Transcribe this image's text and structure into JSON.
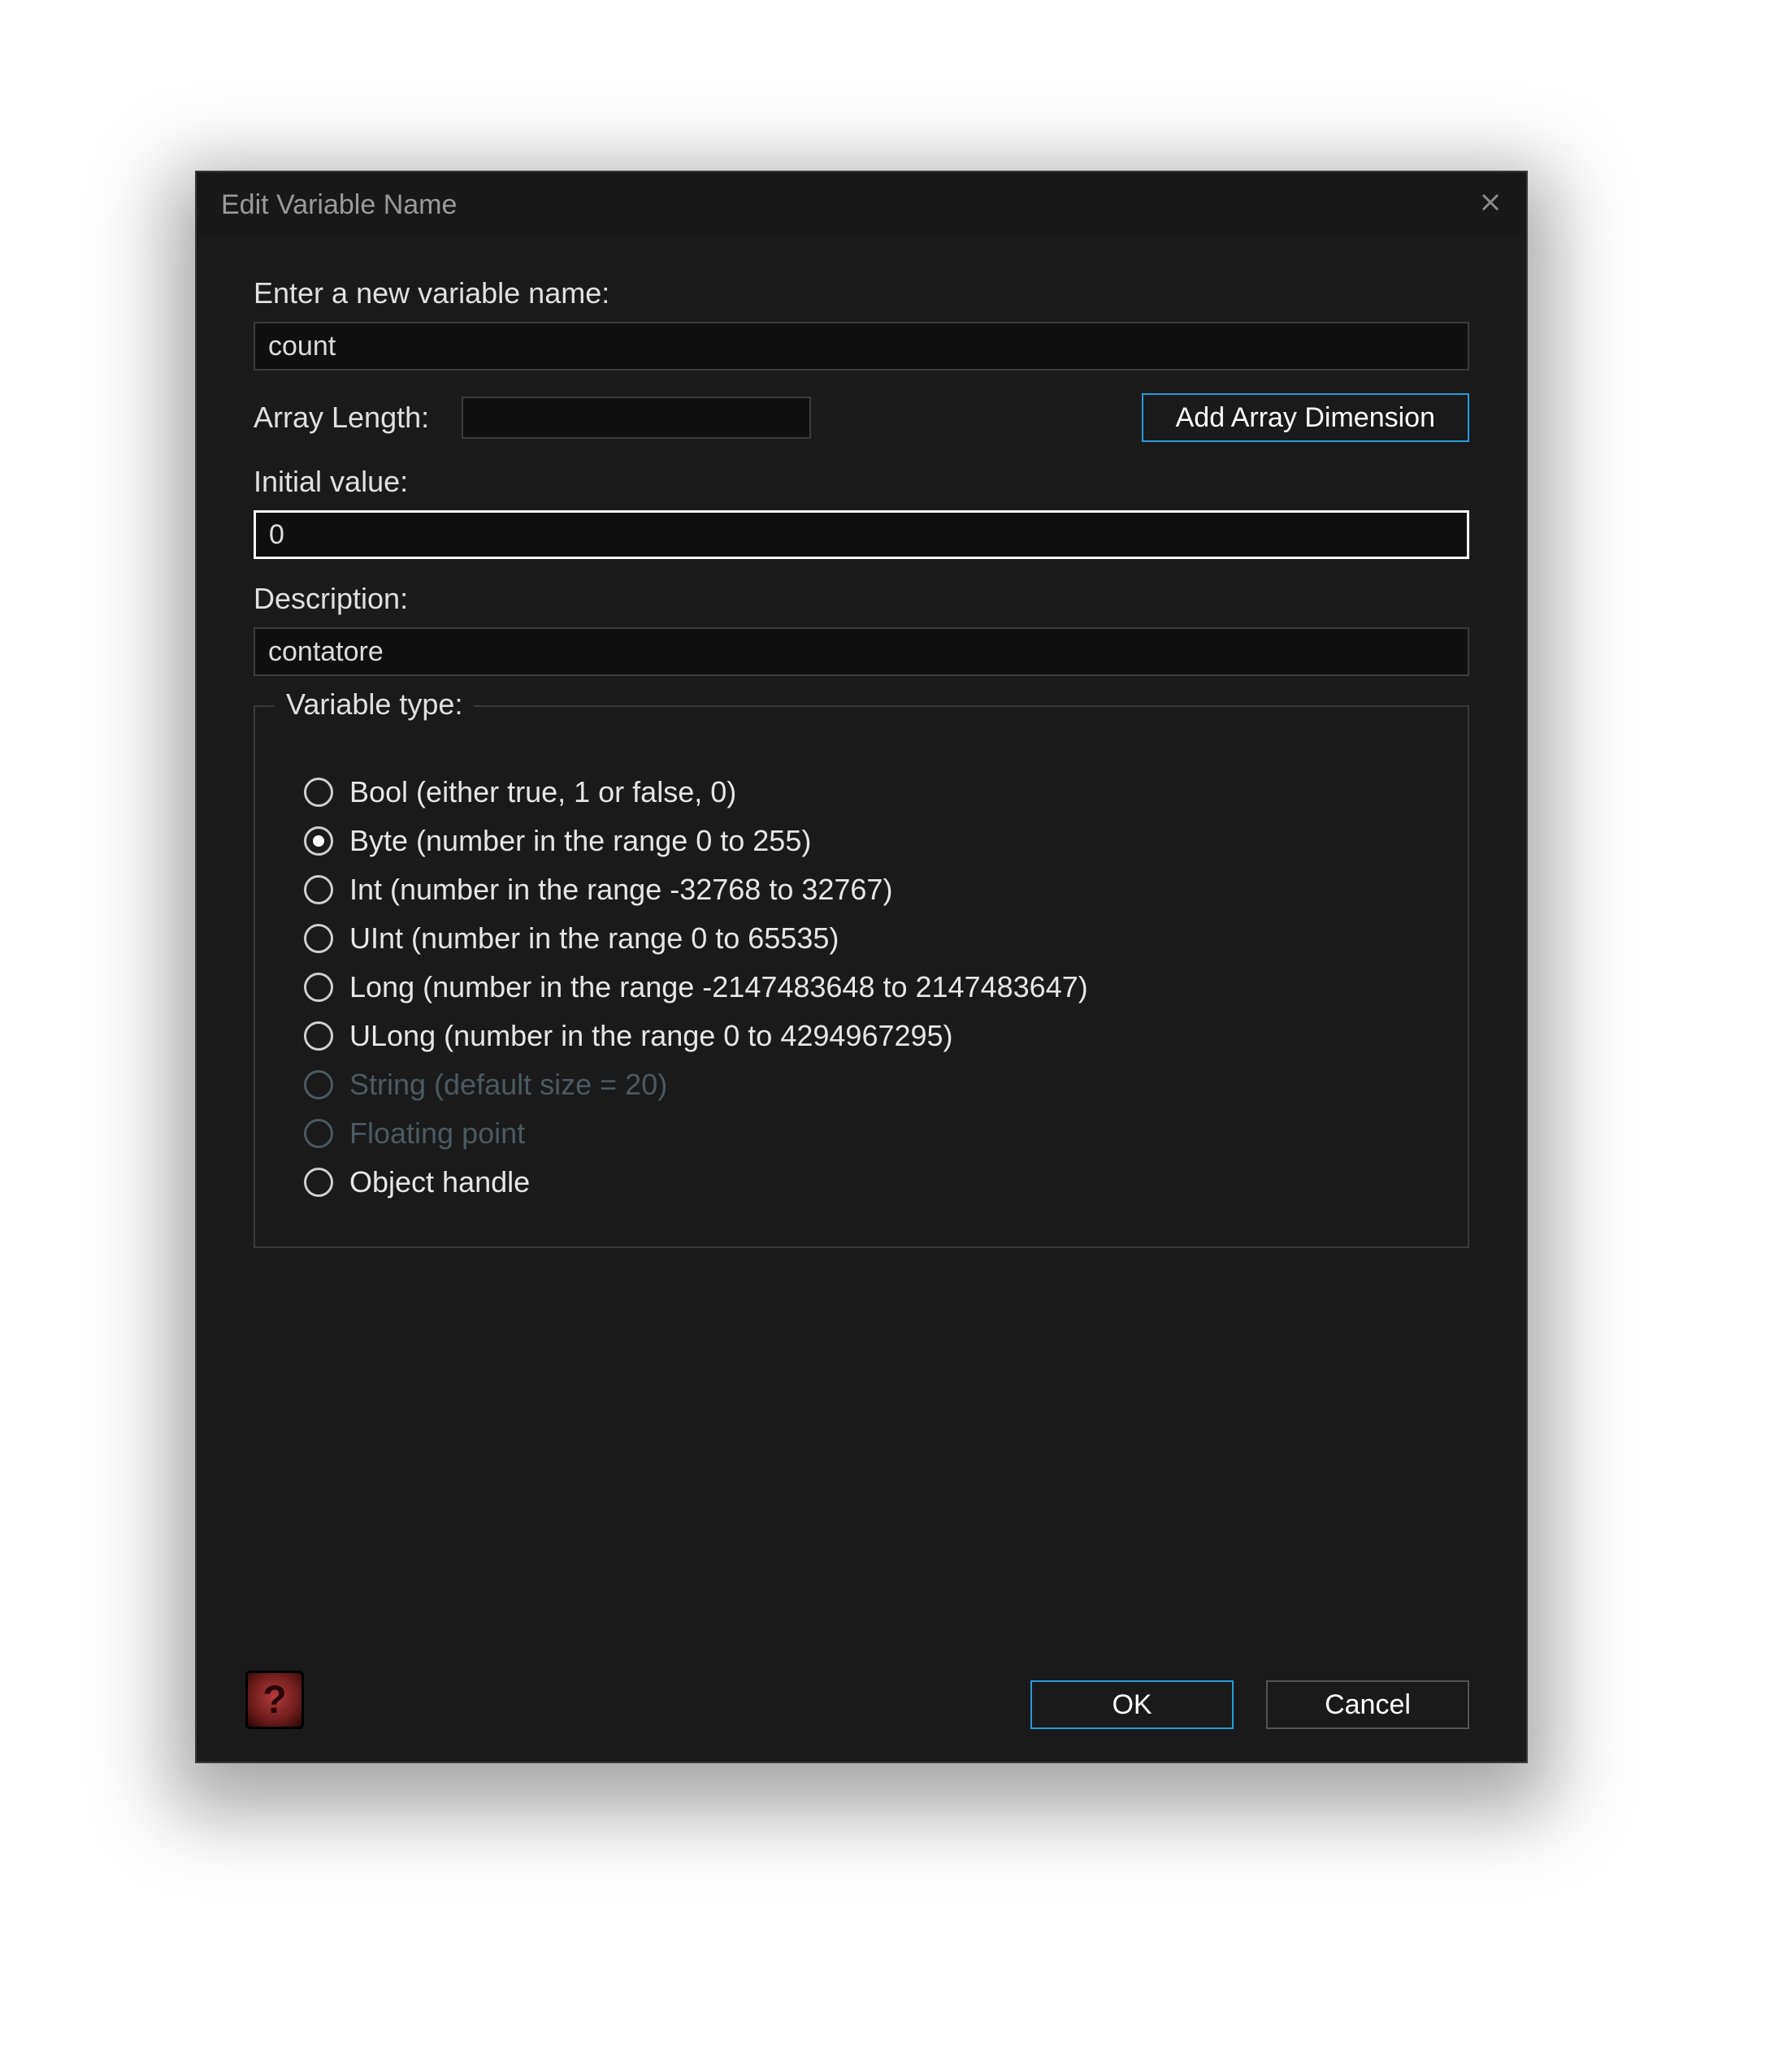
{
  "title": "Edit Variable Name",
  "labels": {
    "enter_name": "Enter a new variable name:",
    "array_length": "Array Length:",
    "initial_value": "Initial value:",
    "description": "Description:",
    "variable_type": "Variable type:"
  },
  "inputs": {
    "name_value": "count",
    "array_length_value": "",
    "initial_value": "0",
    "description_value": "contatore"
  },
  "buttons": {
    "add_array_dim": "Add Array Dimension",
    "ok": "OK",
    "cancel": "Cancel"
  },
  "help_text": "?",
  "variable_types": [
    {
      "id": "bool",
      "label": "Bool (either true, 1 or false, 0)",
      "checked": false,
      "disabled": false
    },
    {
      "id": "byte",
      "label": "Byte (number in the range 0 to 255)",
      "checked": true,
      "disabled": false
    },
    {
      "id": "int",
      "label": "Int (number in the range -32768 to 32767)",
      "checked": false,
      "disabled": false
    },
    {
      "id": "uint",
      "label": "UInt (number in the range 0 to 65535)",
      "checked": false,
      "disabled": false
    },
    {
      "id": "long",
      "label": "Long (number in the range -2147483648 to 2147483647)",
      "checked": false,
      "disabled": false
    },
    {
      "id": "ulong",
      "label": "ULong (number in the range 0 to 4294967295)",
      "checked": false,
      "disabled": false
    },
    {
      "id": "string",
      "label": "String (default size = 20)",
      "checked": false,
      "disabled": true
    },
    {
      "id": "float",
      "label": "Floating point",
      "checked": false,
      "disabled": true
    },
    {
      "id": "handle",
      "label": "Object handle",
      "checked": false,
      "disabled": false
    }
  ]
}
